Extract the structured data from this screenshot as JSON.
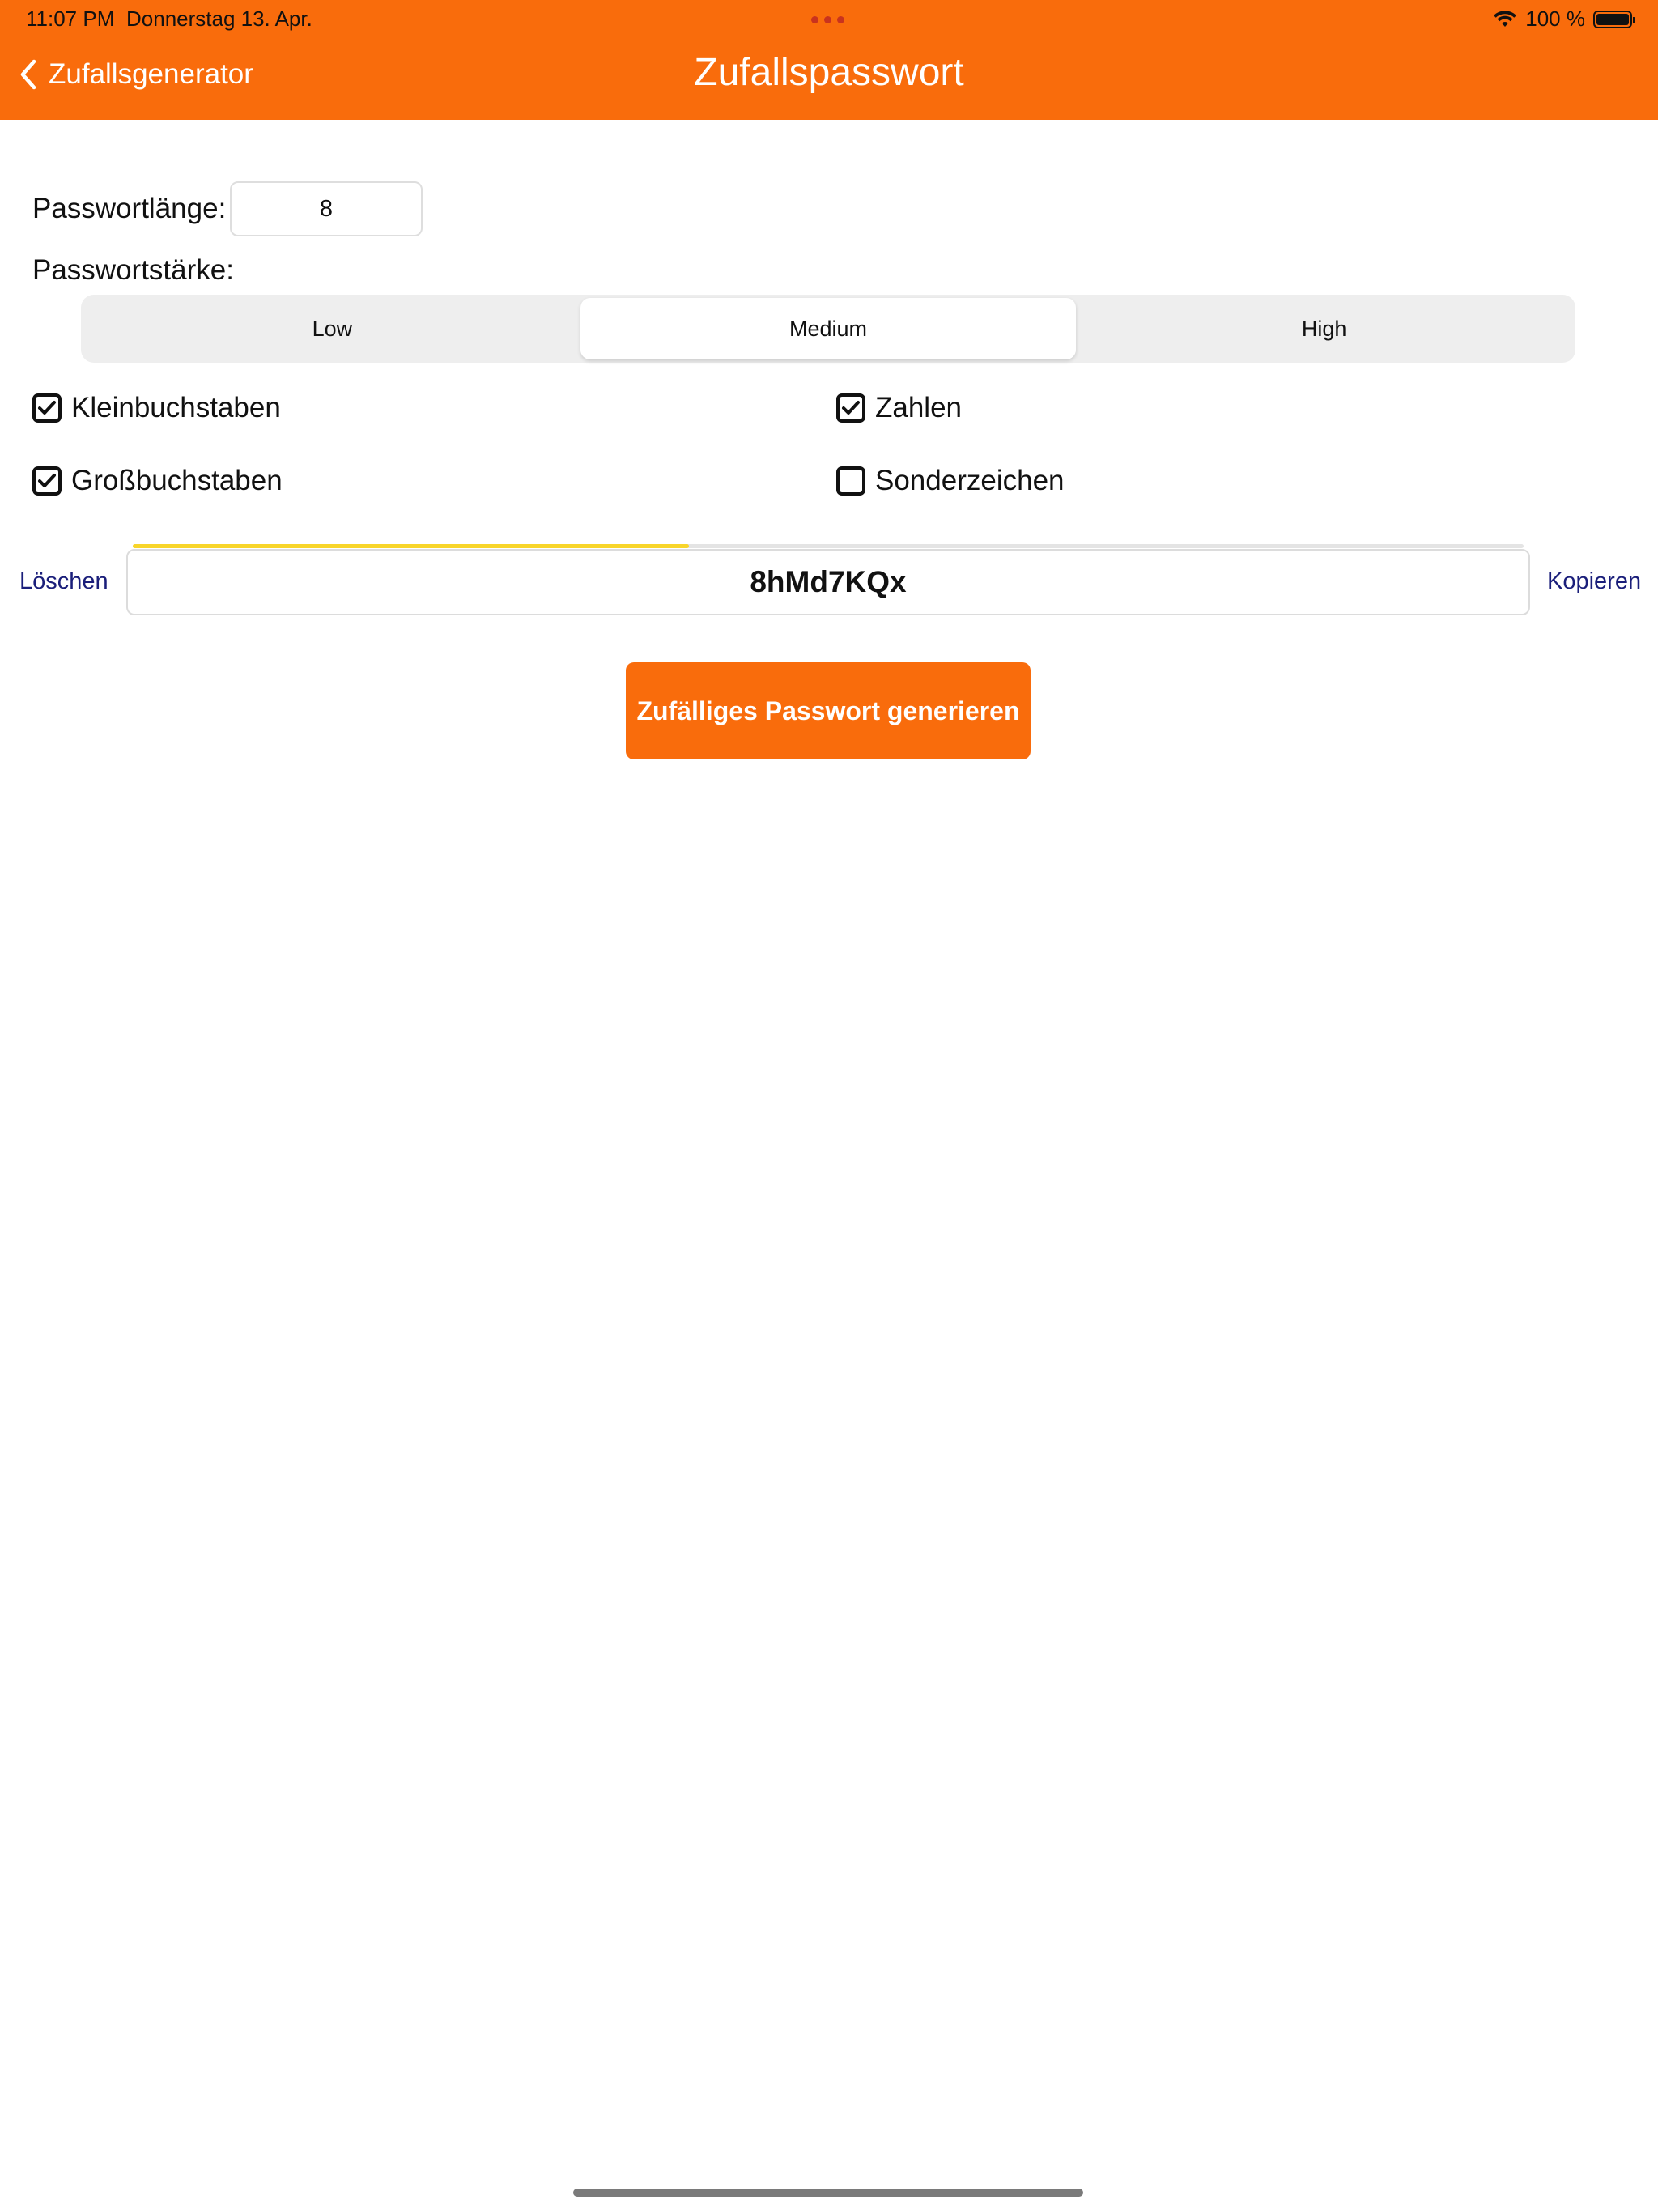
{
  "status_bar": {
    "time": "11:07 PM",
    "date": "Donnerstag 13. Apr.",
    "battery": "100 %",
    "battery_level": 1.0
  },
  "nav": {
    "back_label": "Zufallsgenerator",
    "title": "Zufallspasswort"
  },
  "form": {
    "length_label": "Passwortlänge:",
    "length_value": "8",
    "strength_label": "Passwortstärke:",
    "strength_options": [
      "Low",
      "Medium",
      "High"
    ],
    "strength_selected": "Medium",
    "options": [
      {
        "label": "Kleinbuchstaben",
        "checked": true
      },
      {
        "label": "Zahlen",
        "checked": true
      },
      {
        "label": "Großbuchstaben",
        "checked": true
      },
      {
        "label": "Sonderzeichen",
        "checked": false
      }
    ]
  },
  "result": {
    "clear_label": "Löschen",
    "copy_label": "Kopieren",
    "password": "8hMd7KQx",
    "strength_level": 0.4,
    "strength_color": "#F8D52A"
  },
  "actions": {
    "generate_label": "Zufälliges Passwort generieren"
  },
  "colors": {
    "accent": "#F96C0C",
    "link": "#1A1E7A"
  }
}
